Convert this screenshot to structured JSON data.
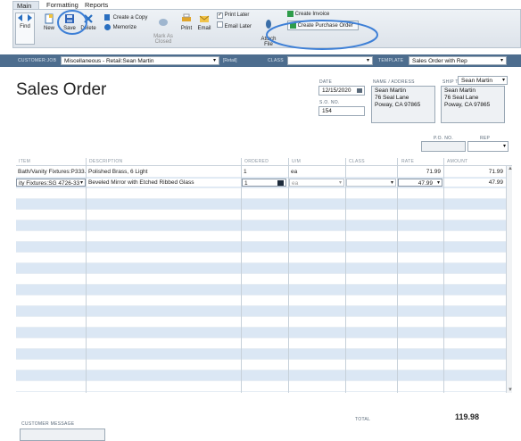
{
  "tabs": {
    "main": "Main",
    "formatting": "Formatting",
    "reports": "Reports"
  },
  "toolbar": {
    "find": "Find",
    "new": "New",
    "save": "Save",
    "delete": "Delete",
    "create_copy": "Create a Copy",
    "memorize": "Memorize",
    "mark_as_closed": "Mark As\nClosed",
    "print": "Print",
    "email": "Email",
    "print_later": "Print Later",
    "email_later": "Email Later",
    "attach_file": "Attach\nFile",
    "create_invoice": "Create Invoice",
    "create_po": "Create Purchase Order"
  },
  "header": {
    "customer_job_label": "CUSTOMER:JOB",
    "customer_job": "Miscellaneous - Retail:Sean Martin",
    "retail_tag": "[Retail]",
    "class_label": "CLASS",
    "class_value": "",
    "template_label": "TEMPLATE",
    "template": "Sales Order with Rep"
  },
  "form": {
    "title": "Sales Order",
    "date_label": "DATE",
    "date": "12/15/2020",
    "so_label": "S.O. NO.",
    "so_no": "154",
    "name_address_label": "NAME / ADDRESS",
    "name_address": [
      "Sean Martin",
      "76 Seal Lane",
      "Poway, CA 97865"
    ],
    "ship_to_label": "SHIP TO",
    "ship_to_select": "Sean Martin",
    "ship_to": [
      "Sean Martin",
      "76 Seal Lane",
      "Poway, CA 97865"
    ],
    "po_label": "P.O. NO.",
    "rep_label": "REP"
  },
  "grid": {
    "columns": [
      "ITEM",
      "DESCRIPTION",
      "ORDERED",
      "U/M",
      "CLASS",
      "RATE",
      "AMOUNT"
    ],
    "rows": [
      {
        "item": "Bath/Vanity Fixtures:P333...",
        "description": "Polished Brass, 6 Light",
        "ordered": "1",
        "um": "ea",
        "class": "",
        "rate": "71.99",
        "amount": "71.99"
      },
      {
        "item": "ity Fixtures:SG 4726-33",
        "description": "Beveled Mirror with Etched Ribbed Glass",
        "ordered": "1",
        "um": "ea",
        "class": "",
        "rate": "47.99",
        "amount": "47.99"
      }
    ]
  },
  "footer": {
    "customer_message_label": "CUSTOMER MESSAGE",
    "total_label": "TOTAL",
    "total": "119.98"
  },
  "colors": {
    "accent": "#4d6d8e",
    "row_stripe": "#dbe7f4",
    "highlight_circle": "#3d7fd6"
  }
}
